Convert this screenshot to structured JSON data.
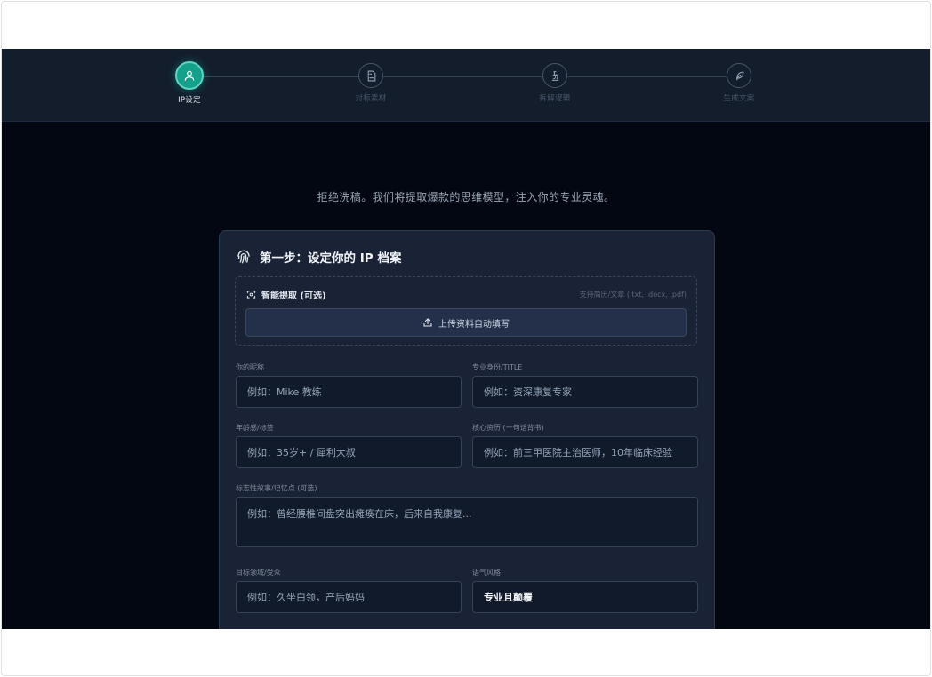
{
  "stepper": {
    "steps": [
      {
        "label": "IP设定",
        "icon": "user-icon",
        "active": true
      },
      {
        "label": "对标素材",
        "icon": "document-icon",
        "active": false
      },
      {
        "label": "拆解逻辑",
        "icon": "microscope-icon",
        "active": false
      },
      {
        "label": "生成文案",
        "icon": "feather-icon",
        "active": false
      }
    ]
  },
  "tagline": "拒绝洗稿。我们将提取爆款的思维模型，注入你的专业灵魂。",
  "card": {
    "title": "第一步：设定你的 IP 档案",
    "title_icon": "fingerprint-icon",
    "extract": {
      "title": "智能提取 (可选)",
      "icon": "scan-icon",
      "note": "支持简历/文章 (.txt, .docx, .pdf)",
      "upload_label": "上传资料自动填写",
      "upload_icon": "upload-icon"
    },
    "fields": {
      "nickname": {
        "label": "你的昵称",
        "placeholder": "例如：Mike 教练"
      },
      "identity": {
        "label": "专业身份/TITLE",
        "placeholder": "例如：资深康复专家"
      },
      "age_tag": {
        "label": "年龄感/标签",
        "placeholder": "例如：35岁+ / 犀利大叔"
      },
      "credentials": {
        "label": "核心资历 (一句话背书)",
        "placeholder": "例如：前三甲医院主治医师，10年临床经验"
      },
      "story": {
        "label": "标志性故事/记忆点 (可选)",
        "placeholder": "例如：曾经腰椎间盘突出瘫痪在床，后来自我康复..."
      },
      "audience": {
        "label": "目标领域/受众",
        "placeholder": "例如：久坐白领，产后妈妈"
      },
      "tone": {
        "label": "语气风格",
        "value": "专业且颠覆"
      }
    }
  },
  "colors": {
    "accent": "#14a08a",
    "background": "#020712",
    "card": "#1a2335",
    "header": "#131d2c"
  }
}
